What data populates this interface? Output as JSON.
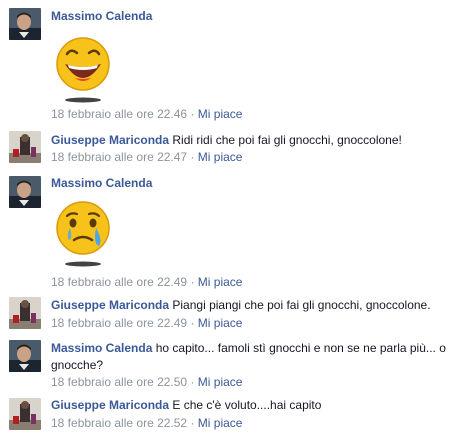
{
  "comments": [
    {
      "author": "Massimo Calenda",
      "text": "",
      "sticker": "laughing-face-sticker",
      "time": "18 febbraio alle ore 22.46",
      "sep": " · ",
      "like": "Mi piace"
    },
    {
      "author": "Giuseppe Mariconda",
      "text": "Ridi ridi che poi fai gli gnocchi, gnoccolone!",
      "time": "18 febbraio alle ore 22.47",
      "sep": " · ",
      "like": "Mi piace"
    },
    {
      "author": "Massimo Calenda",
      "text": "",
      "sticker": "crying-face-sticker",
      "time": "18 febbraio alle ore 22.49",
      "sep": " · ",
      "like": "Mi piace"
    },
    {
      "author": "Giuseppe Mariconda",
      "text": "Piangi piangi che poi fai gli gnocchi, gnoccolone.",
      "time": "18 febbraio alle ore 22.49",
      "sep": " · ",
      "like": "Mi piace"
    },
    {
      "author": "Massimo Calenda",
      "text": "ho capito... famoli stì gnocchi e non se ne parla più... o gnocche?",
      "time": "18 febbraio alle ore 22.50",
      "sep": " · ",
      "like": "Mi piace"
    },
    {
      "author": "Giuseppe Mariconda",
      "text": "E che c'è voluto....hai capito",
      "time": "18 febbraio alle ore 22.52",
      "sep": " · ",
      "like": "Mi piace"
    }
  ],
  "colors": {
    "link": "#3b5998",
    "meta": "#8d949e",
    "text": "#141823",
    "sticker_yellow": "#f7c21a",
    "tear_blue": "#4aa8e8"
  }
}
